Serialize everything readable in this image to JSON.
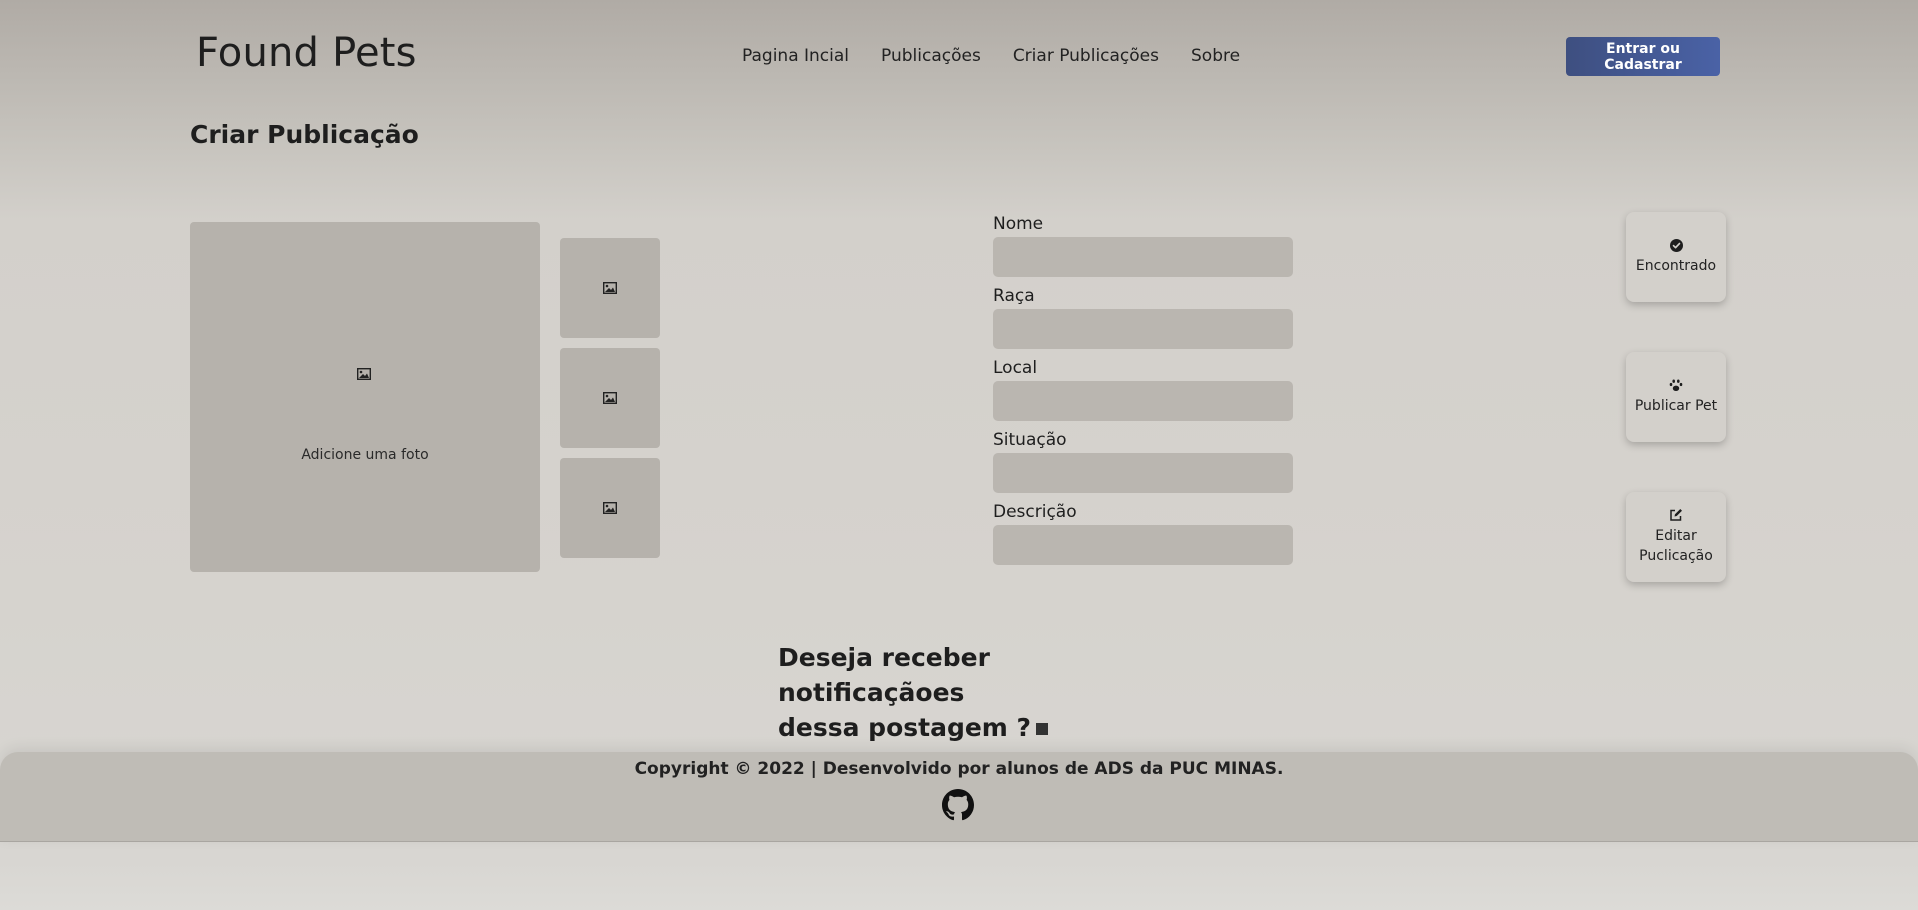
{
  "header": {
    "brand": "Found Pets",
    "nav": [
      "Pagina Incial",
      "Publicações",
      "Criar Publicações",
      "Sobre"
    ],
    "login_label": "Entrar ou Cadastrar"
  },
  "page": {
    "title": "Criar Publicação"
  },
  "photos": {
    "main_caption": "Adicione uma foto",
    "main_icon": "image-icon",
    "thumb_icon": "image-icon"
  },
  "form": {
    "fields": [
      {
        "label": "Nome",
        "value": ""
      },
      {
        "label": "Raça",
        "value": ""
      },
      {
        "label": "Local",
        "value": ""
      },
      {
        "label": "Situação",
        "value": ""
      },
      {
        "label": "Descrição",
        "value": ""
      }
    ]
  },
  "actions": [
    {
      "label": "Encontrado",
      "icon": "check-circle-icon"
    },
    {
      "label": "Publicar Pet",
      "icon": "paw-icon"
    },
    {
      "label": "Editar Puclicação",
      "icon": "edit-icon"
    }
  ],
  "notify": {
    "line1": "Deseja receber notificaçãoes",
    "line2": "dessa postagem ?"
  },
  "footer": {
    "copyright": "Copyright © 2022 | Desenvolvido por alunos de ADS da PUC MINAS.",
    "icon": "github-icon"
  },
  "colors": {
    "login_button": "#4a5f9e",
    "photo_placeholder": "#b6b2ac",
    "input_bg": "#bab6b0",
    "footer_bg": "#bfbcb6"
  }
}
